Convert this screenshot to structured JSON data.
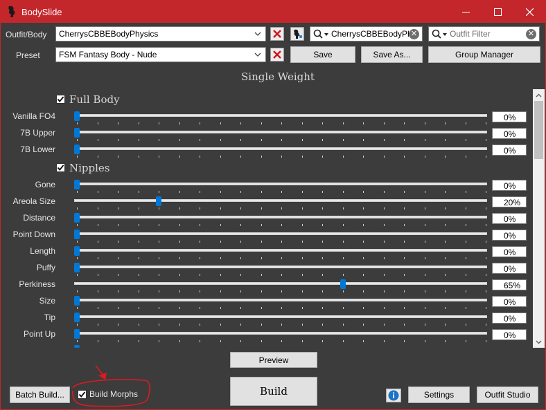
{
  "window": {
    "title": "BodySlide"
  },
  "outfit": {
    "label": "Outfit/Body",
    "value": "CherrysCBBEBodyPhysics",
    "search_value": "CherrysCBBEBodyPh",
    "filter_placeholder": "Outfit Filter"
  },
  "preset": {
    "label": "Preset",
    "value": "FSM Fantasy Body - Nude",
    "save_label": "Save",
    "save_as_label": "Save As...",
    "group_manager_label": "Group Manager"
  },
  "weight_heading": "Single Weight",
  "groups": [
    {
      "name": "Full Body",
      "checked": true,
      "sliders": [
        {
          "label": "Vanilla FO4",
          "value": "0%",
          "level": 0
        },
        {
          "label": "7B Upper",
          "value": "0%",
          "level": 0
        },
        {
          "label": "7B Lower",
          "value": "0%",
          "level": 0
        }
      ]
    },
    {
      "name": "Nipples",
      "checked": true,
      "sliders": [
        {
          "label": "Gone",
          "value": "0%",
          "level": 0
        },
        {
          "label": "Areola Size",
          "value": "20%",
          "level": 20
        },
        {
          "label": "Distance",
          "value": "0%",
          "level": 0
        },
        {
          "label": "Point Down",
          "value": "0%",
          "level": 0
        },
        {
          "label": "Length",
          "value": "0%",
          "level": 0
        },
        {
          "label": "Puffy",
          "value": "0%",
          "level": 0
        },
        {
          "label": "Perkiness",
          "value": "65%",
          "level": 65
        },
        {
          "label": "Size",
          "value": "0%",
          "level": 0
        },
        {
          "label": "Tip",
          "value": "0%",
          "level": 0
        },
        {
          "label": "Point Up",
          "value": "0%",
          "level": 0
        }
      ]
    }
  ],
  "footer": {
    "preview_label": "Preview",
    "build_label": "Build",
    "batch_build_label": "Batch Build...",
    "build_morphs_label": "Build Morphs",
    "build_morphs_checked": true,
    "settings_label": "Settings",
    "outfit_studio_label": "Outfit Studio"
  },
  "colors": {
    "accent": "#c3272b",
    "slider_thumb": "#0078d7",
    "background": "#3c3c3c",
    "annotation": "#e0181f"
  },
  "icons": [
    "bodyslide-logo-icon",
    "minimize-icon",
    "maximize-icon",
    "close-icon",
    "chevron-down-icon",
    "delete-x-icon",
    "outfit-studio-link-icon",
    "search-filter-icon",
    "clear-icon",
    "checkbox-check-icon",
    "info-icon",
    "scroll-up-icon",
    "scroll-down-icon",
    "arrow-annotation"
  ]
}
